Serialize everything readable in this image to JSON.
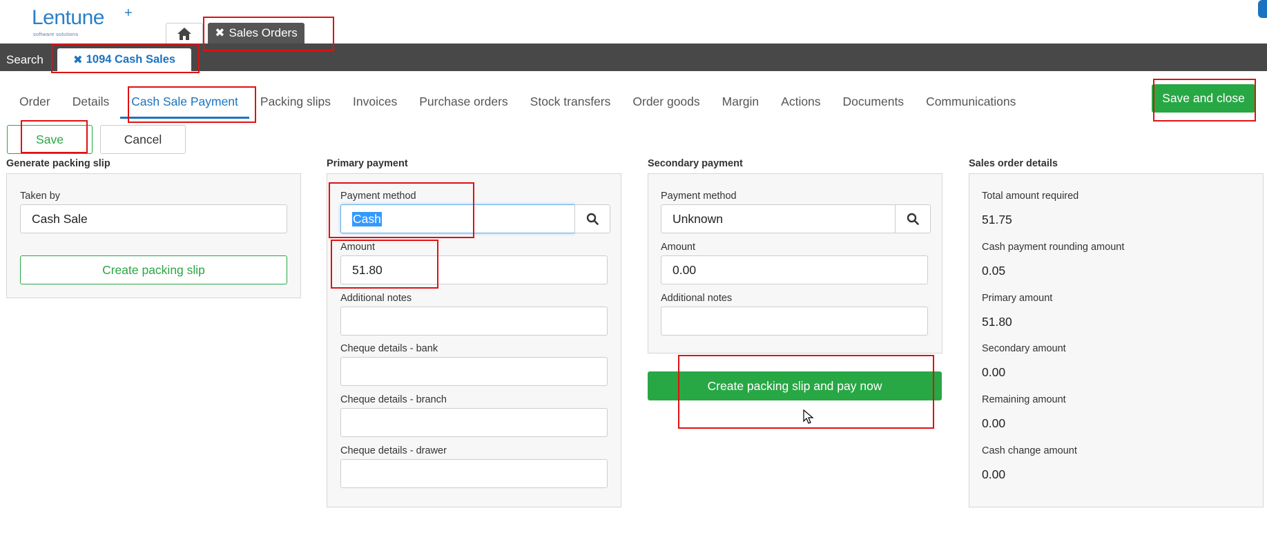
{
  "app": {
    "logo_name": "Lentune",
    "logo_subtitle": "software solutions"
  },
  "top_tabs": {
    "home_icon": "home-icon",
    "sales_orders_label": "Sales Orders",
    "close_glyph": "✖"
  },
  "search_bar": {
    "search_label": "Search",
    "record_tab_label": "1094 Cash Sales",
    "close_glyph": "✖"
  },
  "nav_tabs": [
    {
      "label": "Order"
    },
    {
      "label": "Details"
    },
    {
      "label": "Cash Sale Payment",
      "active": true
    },
    {
      "label": "Packing slips"
    },
    {
      "label": "Invoices"
    },
    {
      "label": "Purchase orders"
    },
    {
      "label": "Stock transfers"
    },
    {
      "label": "Order goods"
    },
    {
      "label": "Margin"
    },
    {
      "label": "Actions"
    },
    {
      "label": "Documents"
    },
    {
      "label": "Communications"
    }
  ],
  "actions": {
    "save_and_close": "Save and close",
    "save": "Save",
    "cancel": "Cancel"
  },
  "generate_packing_slip": {
    "title": "Generate packing slip",
    "taken_by_label": "Taken by",
    "taken_by_value": "Cash Sale",
    "create_button": "Create packing slip"
  },
  "primary_payment": {
    "title": "Primary payment",
    "payment_method_label": "Payment method",
    "payment_method_value": "Cash",
    "amount_label": "Amount",
    "amount_value": "51.80",
    "additional_notes_label": "Additional notes",
    "additional_notes_value": "",
    "cheque_bank_label": "Cheque details - bank",
    "cheque_bank_value": "",
    "cheque_branch_label": "Cheque details - branch",
    "cheque_branch_value": "",
    "cheque_drawer_label": "Cheque details - drawer",
    "cheque_drawer_value": ""
  },
  "secondary_payment": {
    "title": "Secondary payment",
    "payment_method_label": "Payment method",
    "payment_method_value": "Unknown",
    "amount_label": "Amount",
    "amount_value": "0.00",
    "additional_notes_label": "Additional notes",
    "additional_notes_value": "",
    "create_and_pay_button": "Create packing slip and pay now"
  },
  "sales_order_details": {
    "title": "Sales order details",
    "total_required_label": "Total amount required",
    "total_required_value": "51.75",
    "rounding_label": "Cash payment rounding amount",
    "rounding_value": "0.05",
    "primary_amount_label": "Primary amount",
    "primary_amount_value": "51.80",
    "secondary_amount_label": "Secondary amount",
    "secondary_amount_value": "0.00",
    "remaining_label": "Remaining amount",
    "remaining_value": "0.00",
    "change_label": "Cash change amount",
    "change_value": "0.00"
  },
  "colors": {
    "accent_blue": "#1a73c0",
    "success_green": "#28a745",
    "dark_bar": "#484848",
    "annotation_red": "#e01010"
  }
}
